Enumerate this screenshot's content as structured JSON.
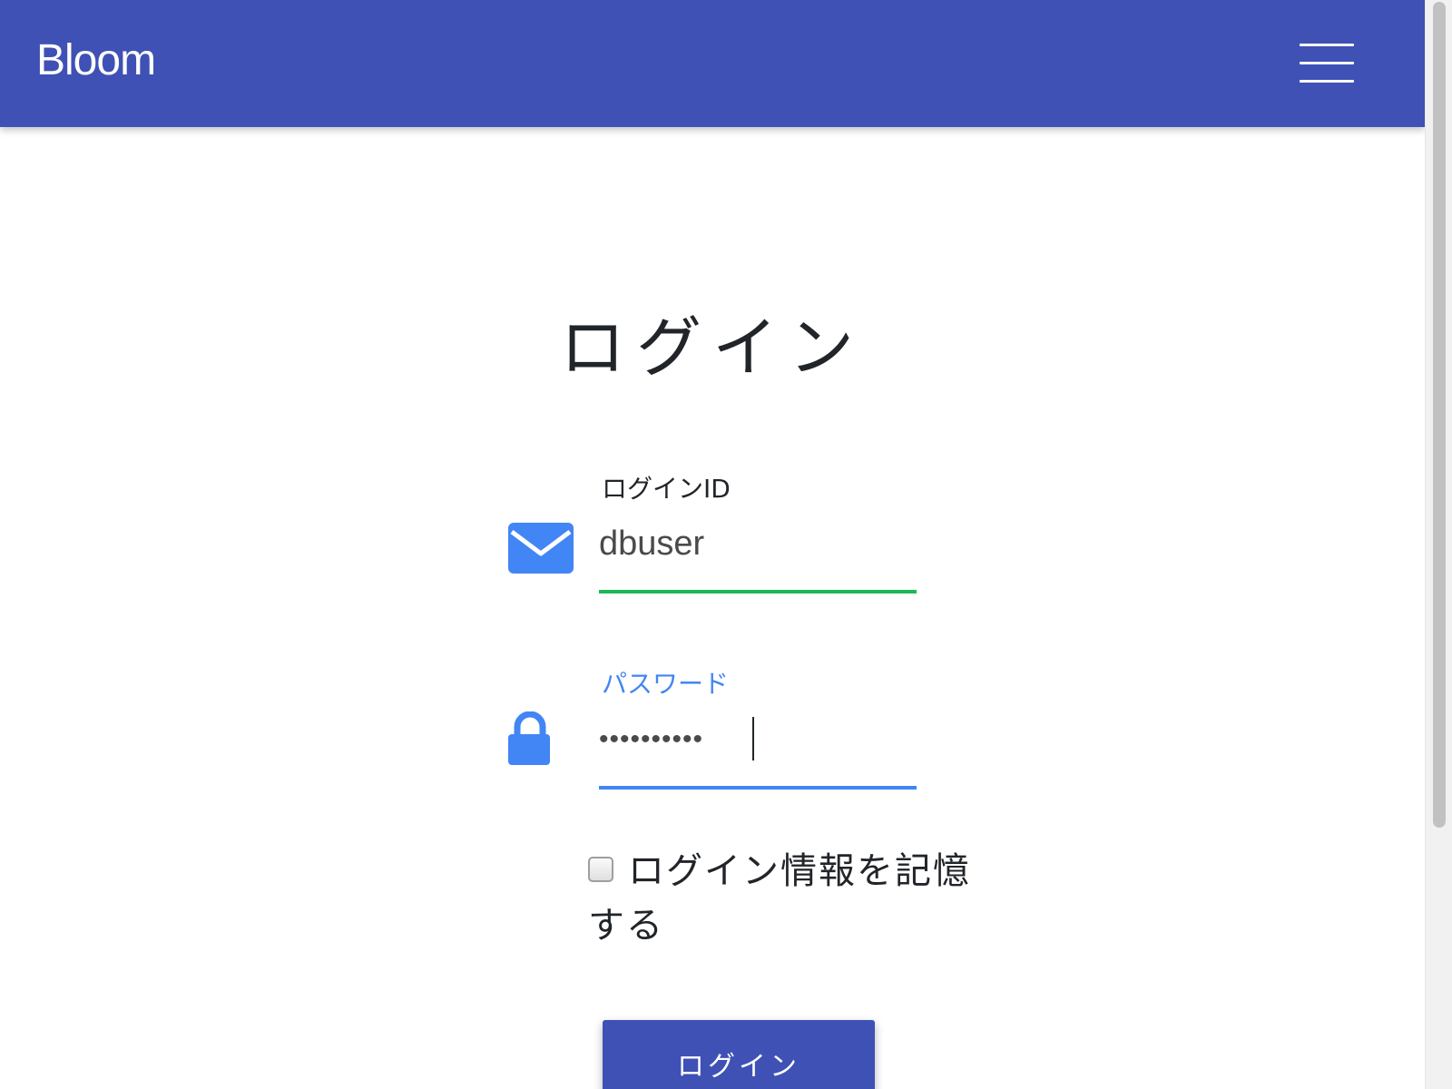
{
  "navbar": {
    "brand": "Bloom",
    "background_color": "#3f51b5",
    "menu_icon": "hamburger-menu-icon"
  },
  "login": {
    "title": "ログイン",
    "login_id": {
      "label": "ログインID",
      "value": "dbuser",
      "icon": "envelope-icon",
      "underline_color": "#1db954"
    },
    "password": {
      "label": "パスワード",
      "value": "••••••••••",
      "icon": "lock-icon",
      "label_color": "#4285f4",
      "underline_color": "#4285f4"
    },
    "remember_label": "ログイン情報を記憶する",
    "remember_checked": false,
    "submit_label": "ログイン"
  },
  "colors": {
    "accent": "#3f51b5",
    "icon_blue": "#4285f4",
    "valid_green": "#1db954"
  }
}
